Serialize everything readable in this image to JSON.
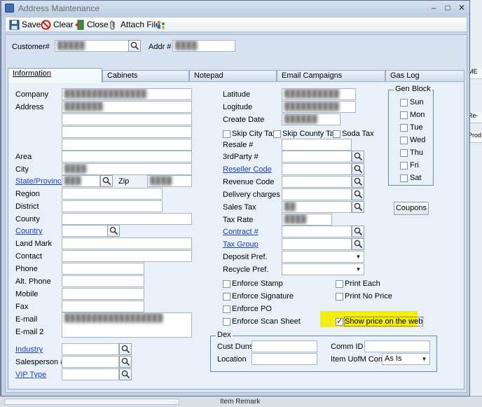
{
  "window": {
    "title": "Address Maintenance",
    "controls": [
      "–",
      "□",
      "✕"
    ]
  },
  "toolbar": {
    "save": "Save",
    "clear": "Clear",
    "close": "Close",
    "attach": "Attach File"
  },
  "customer": {
    "label": "Customer#",
    "value": "█████",
    "addr_label": "Addr #",
    "addr_value": "████"
  },
  "tabs": [
    "Information",
    "Cabinets",
    "Notepad",
    "Email Campaigns",
    "Gas Log"
  ],
  "left": {
    "company": "Company",
    "address": "Address",
    "area": "Area",
    "city": "City",
    "state": "State/Province",
    "zip": "Zip",
    "region": "Region",
    "district": "District",
    "county": "County",
    "country": "Country",
    "landmark": "Land Mark",
    "contact": "Contact",
    "phone": "Phone",
    "altphone": "Alt. Phone",
    "mobile": "Mobile",
    "fax": "Fax",
    "email": "E-mail",
    "email2": "E-mail 2",
    "industry": "Industry",
    "salesperson": "Salesperson #",
    "viptype": "VIP Type",
    "company_value": "███████████████",
    "address_value": "███████",
    "city_value": "████",
    "state_value": "███",
    "zip_value": "████",
    "email_value": "██████████████████"
  },
  "middle": {
    "latitude": "Latitude",
    "longitude": "Logitude",
    "createdate": "Create Date",
    "skipcity": "Skip City Tax",
    "skipcounty": "Skip County Tax",
    "sodatax": "Soda Tax",
    "resale": "Resale #",
    "thirdparty": "3rdParty #",
    "resellercode": "Reseller Code",
    "revenuecode": "Revenue Code",
    "deliverycharges": "Delivery charges",
    "salestax": "Sales Tax",
    "taxrate": "Tax Rate",
    "contract": "Contract #",
    "taxgroup": "Tax Group",
    "depositpref": "Deposit Pref.",
    "recyclepref": "Recycle Pref.",
    "latitude_value": "██████████",
    "longitude_value": "██████████",
    "createdate_value": "██████",
    "salestax_value": "██",
    "taxrate_value": "████"
  },
  "checks": {
    "enforcestamp": "Enforce Stamp",
    "enforcesignature": "Enforce Signature",
    "enforcepo": "Enforce PO",
    "enforcescan": "Enforce Scan Sheet",
    "printeach": "Print Each",
    "printnoprice": "Print No Price",
    "showprice": "Show price on the web",
    "showprice_checked": true
  },
  "genblock": {
    "caption": "Gen Block",
    "days": [
      "Sun",
      "Mon",
      "Tue",
      "Wed",
      "Thu",
      "Fri",
      "Sat"
    ]
  },
  "coupons": "Coupons",
  "dex": {
    "caption": "Dex",
    "custduns": "Cust Duns",
    "location": "Location",
    "commid": "Comm ID",
    "itemuofm": "Item UofM Conv.",
    "itemuofm_value": "As Is"
  },
  "background": {
    "right_labels": [
      "ME",
      "Re-",
      "Prod"
    ],
    "bottom_label": "Item Remark"
  },
  "colors": {
    "highlight": "#f2ee14",
    "link": "#1a3fb5",
    "groupbox": "#5b8bc9"
  }
}
